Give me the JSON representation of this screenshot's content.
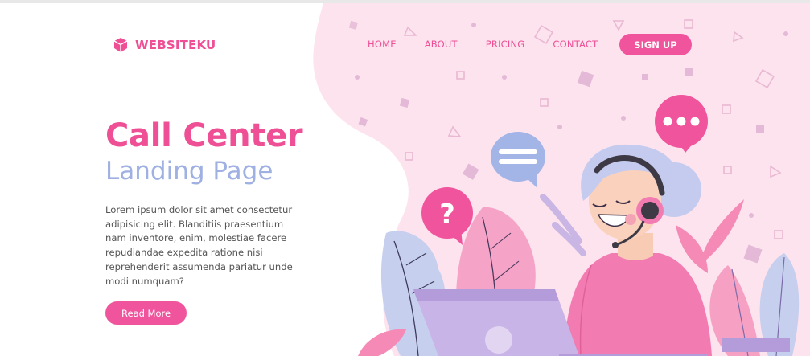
{
  "brand": {
    "name": "WEBSITEKU",
    "icon": "cube-icon",
    "color": "#ee4f95"
  },
  "nav": {
    "items": [
      {
        "label": "HOME"
      },
      {
        "label": "ABOUT"
      },
      {
        "label": "PRICING"
      },
      {
        "label": "CONTACT"
      }
    ],
    "signup_label": "SIGN UP"
  },
  "hero": {
    "title": "Call Center",
    "subtitle": "Landing Page",
    "description": "Lorem ipsum dolor sit amet consectetur adipisicing elit. Blanditiis praesentium nam inventore, enim, molestiae facere repudiandae expedita ratione nisi reprehenderit assumenda pariatur unde modi numquam?",
    "cta_label": "Read More"
  },
  "colors": {
    "accent": "#f0549d",
    "title": "#ee4f95",
    "subtitle": "#9fb0e2",
    "background_blob": "#fde3ee"
  },
  "illustration": {
    "icons": [
      "chat-bubble-dots-icon",
      "chat-bubble-lines-icon",
      "question-bubble-icon",
      "headset-icon",
      "laptop-icon"
    ]
  }
}
